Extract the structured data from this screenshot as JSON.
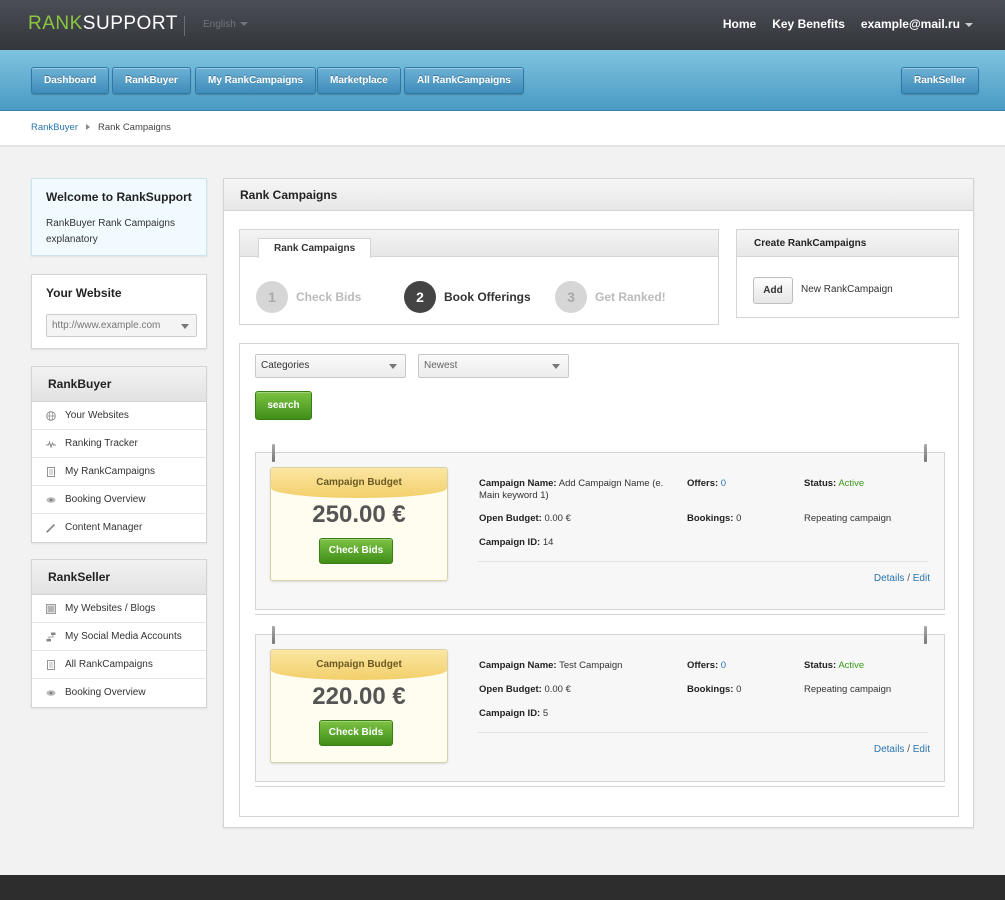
{
  "header": {
    "logo_part1": "RANK",
    "logo_part2": "SUPPORT",
    "language": "English",
    "nav": [
      "Home",
      "Key Benefits",
      "example@mail.ru"
    ]
  },
  "mainnav": {
    "items": [
      "Dashboard",
      "RankBuyer",
      "My RankCampaigns",
      "Marketplace",
      "All RankCampaigns"
    ],
    "right": "RankSeller"
  },
  "breadcrumb": {
    "parent": "RankBuyer",
    "current": "Rank Campaigns"
  },
  "welcome": {
    "title": "Welcome to RankSupport",
    "text": "RankBuyer Rank Campaigns explanatory"
  },
  "your_website": {
    "title": "Your Website",
    "select_value": "http://www.example.com"
  },
  "rankbuyer_menu": {
    "title": "RankBuyer",
    "items": [
      {
        "label": "Your Websites",
        "icon": "globe-icon"
      },
      {
        "label": "Ranking Tracker",
        "icon": "pulse-icon"
      },
      {
        "label": "My RankCampaigns",
        "icon": "document-icon"
      },
      {
        "label": "Booking Overview",
        "icon": "eye-icon"
      },
      {
        "label": "Content Manager",
        "icon": "pencil-icon"
      }
    ]
  },
  "rankseller_menu": {
    "title": "RankSeller",
    "items": [
      {
        "label": "My Websites / Blogs",
        "icon": "list-icon"
      },
      {
        "label": "My Social Media Accounts",
        "icon": "hierarchy-icon"
      },
      {
        "label": "All RankCampaigns",
        "icon": "document-icon"
      },
      {
        "label": "Booking Overview",
        "icon": "eye-icon"
      }
    ]
  },
  "main": {
    "title": "Rank Campaigns",
    "tab": "Rank Campaigns",
    "steps": [
      {
        "num": "1",
        "label": "Check Bids"
      },
      {
        "num": "2",
        "label": "Book Offerings"
      },
      {
        "num": "3",
        "label": "Get Ranked!"
      }
    ],
    "create": {
      "title": "Create RankCampaigns",
      "add_button": "Add",
      "add_label": "New RankCampaign"
    },
    "filters": {
      "categories": "Categories",
      "sort": "Newest",
      "search_button": "search"
    },
    "campaigns": [
      {
        "budget_label": "Campaign Budget",
        "amount": "250.00 €",
        "check_bids": "Check Bids",
        "name_label": "Campaign Name:",
        "name": "Add Campaign Name (e. Main keyword 1)",
        "open_budget_label": "Open Budget:",
        "open_budget": "0.00 €",
        "id_label": "Campaign ID:",
        "id": "14",
        "offers_label": "Offers:",
        "offers": "0",
        "bookings_label": "Bookings:",
        "bookings": "0",
        "status_label": "Status:",
        "status": "Active",
        "repeat": "Repeating campaign",
        "details": "Details",
        "link_sep": "/",
        "edit": "Edit"
      },
      {
        "budget_label": "Campaign Budget",
        "amount": "220.00 €",
        "check_bids": "Check Bids",
        "name_label": "Campaign Name:",
        "name": "Test Campaign",
        "open_budget_label": "Open Budget:",
        "open_budget": "0.00 €",
        "id_label": "Campaign ID:",
        "id": "5",
        "offers_label": "Offers:",
        "offers": "0",
        "bookings_label": "Bookings:",
        "bookings": "0",
        "status_label": "Status:",
        "status": "Active",
        "repeat": "Repeating campaign",
        "details": "Details",
        "link_sep": "/",
        "edit": "Edit"
      }
    ]
  },
  "colors": {
    "brand_green": "#8cc63f",
    "nav_blue": "#4a9ac4",
    "button_green": "#4f9e22",
    "link_blue": "#2a75b0",
    "status_green": "#3c9a1d"
  }
}
